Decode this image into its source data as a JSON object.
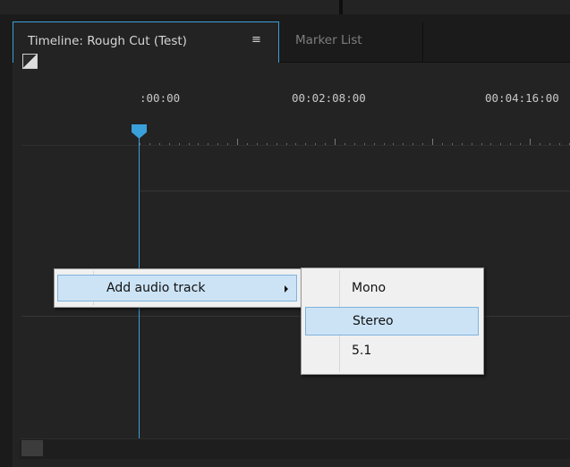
{
  "panel": {
    "tabs": [
      {
        "label": "Timeline: Rough Cut (Test)",
        "menu_glyph": "≡",
        "active": true
      },
      {
        "label": "Marker List",
        "active": false
      }
    ]
  },
  "timeline": {
    "timecodes": [
      ":00:00",
      "00:02:08:00",
      "00:04:16:00"
    ]
  },
  "context_menu": {
    "items": [
      {
        "label": "Add audio track",
        "has_submenu": true,
        "highlighted": true
      }
    ]
  },
  "submenu": {
    "items": [
      {
        "label": "Mono",
        "highlighted": false
      },
      {
        "label": "Stereo",
        "highlighted": true
      },
      {
        "label": "5.1",
        "highlighted": false
      }
    ]
  },
  "icons": {
    "settings": "timeline-settings-icon",
    "panel_menu": "panel-menu-icon",
    "submenu_arrow": "chevron-right-icon"
  },
  "colors": {
    "accent": "#3aa0d9",
    "menu_bg": "#f0f0f0",
    "menu_highlight": "#cce3f6",
    "panel_bg": "#232323"
  }
}
